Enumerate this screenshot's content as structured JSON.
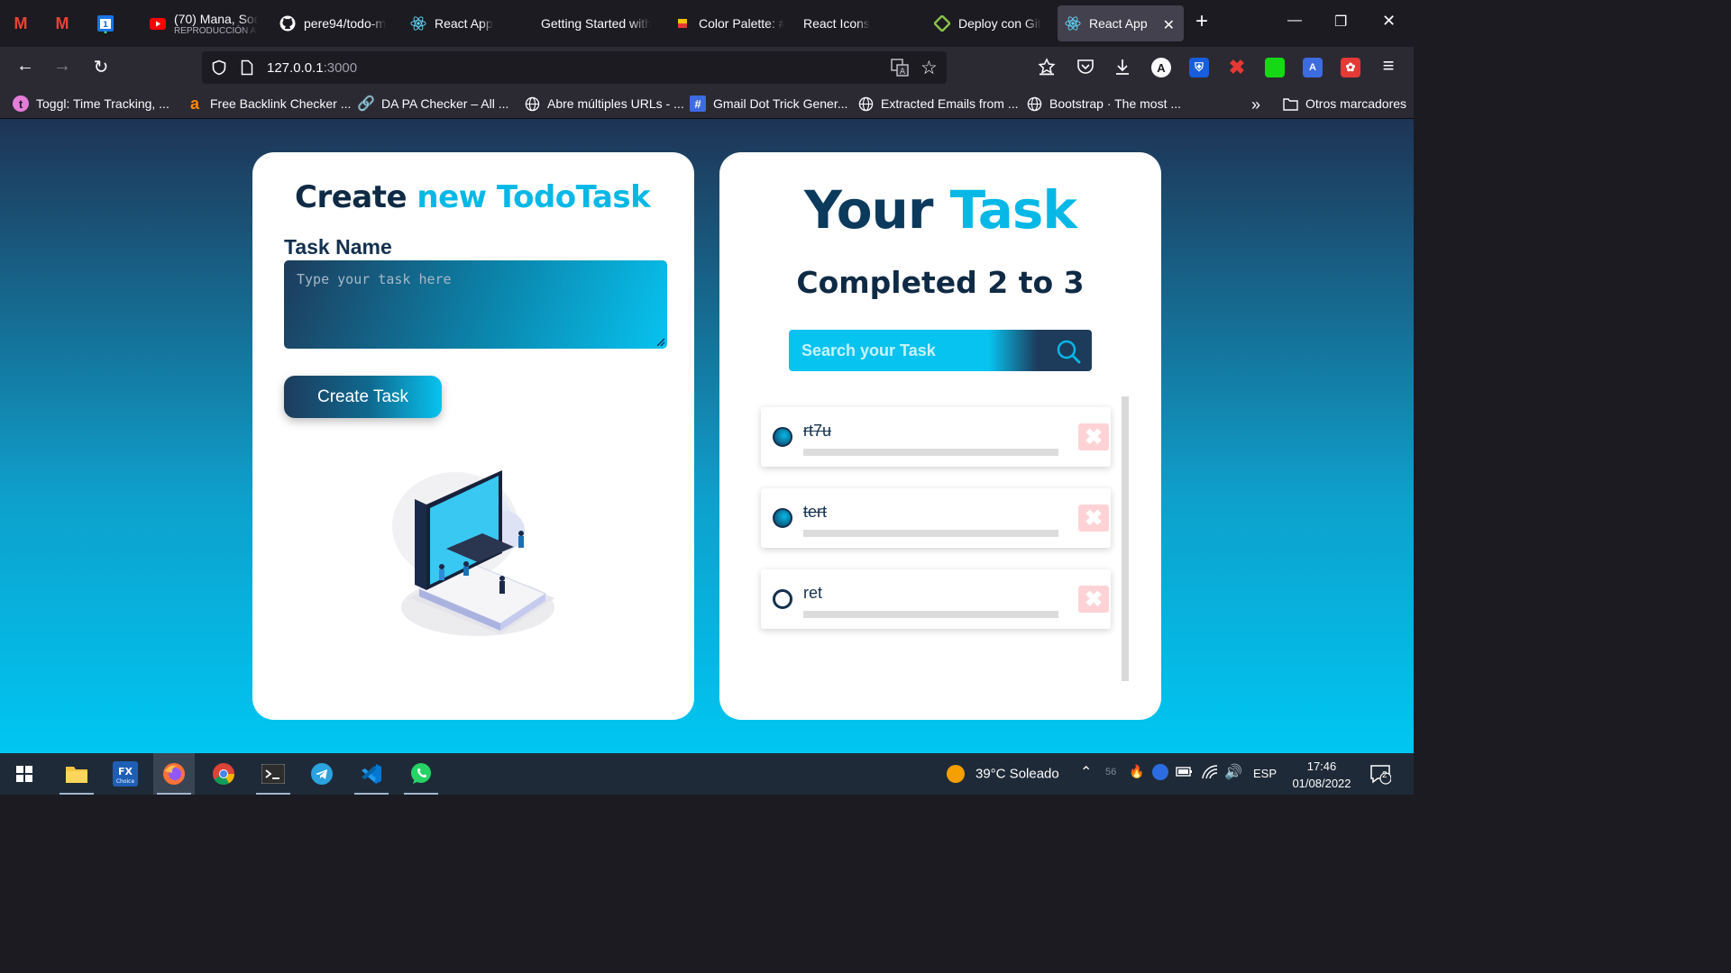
{
  "browser": {
    "tabs": [
      {
        "label": "(70) Mana, Sod",
        "sublabel": "REPRODUCCIÓN AL",
        "icon": "youtube-icon"
      },
      {
        "label": "pere94/todo-m",
        "icon": "github-icon"
      },
      {
        "label": "React App",
        "icon": "react-icon"
      },
      {
        "label": "Getting Started with",
        "icon": "blank-icon"
      },
      {
        "label": "Color Palette: #",
        "icon": "palette-icon"
      },
      {
        "label": "React Icons",
        "icon": "blank-icon"
      },
      {
        "label": "Deploy con Git",
        "icon": "git-icon"
      },
      {
        "label": "React App",
        "icon": "react-icon",
        "active": true
      }
    ],
    "url_host": "127.0.0.1",
    "url_port": ":3000",
    "bookmarks": [
      {
        "label": "Toggl: Time Tracking, ...",
        "icon": "toggl-icon"
      },
      {
        "label": "Free Backlink Checker ...",
        "icon": "ahrefs-icon"
      },
      {
        "label": "DA PA Checker – All ...",
        "icon": "link-icon"
      },
      {
        "label": "Abre múltiples URLs - ...",
        "icon": "globe-icon"
      },
      {
        "label": "Gmail Dot Trick Gener...",
        "icon": "hash-icon"
      },
      {
        "label": "Extracted Emails from ...",
        "icon": "globe-icon"
      },
      {
        "label": "Bootstrap · The most ...",
        "icon": "globe-icon"
      }
    ],
    "other_bookmarks": "Otros marcadores"
  },
  "app": {
    "create": {
      "title_part1": "Create",
      "title_part2": "new TodoTask",
      "task_label": "Task Name",
      "task_placeholder": "Type your task here",
      "button_label": "Create Task"
    },
    "tasks": {
      "title_part1": "Your",
      "title_part2": "Task",
      "completed_text": "Completed 2 to 3",
      "completed_count": 2,
      "total_count": 3,
      "search_placeholder": "Search your Task",
      "items": [
        {
          "text": "rt7u",
          "completed": true
        },
        {
          "text": "tert",
          "completed": true
        },
        {
          "text": "ret",
          "completed": false
        }
      ]
    }
  },
  "taskbar": {
    "weather": "39°C  Soleado",
    "language": "ESP",
    "time": "17:46",
    "date": "01/08/2022",
    "notifications": "2",
    "tray_badge": "56"
  },
  "colors": {
    "accent": "#07b8e6",
    "navy": "#13304f",
    "delete_bg": "#ffd3d6"
  }
}
